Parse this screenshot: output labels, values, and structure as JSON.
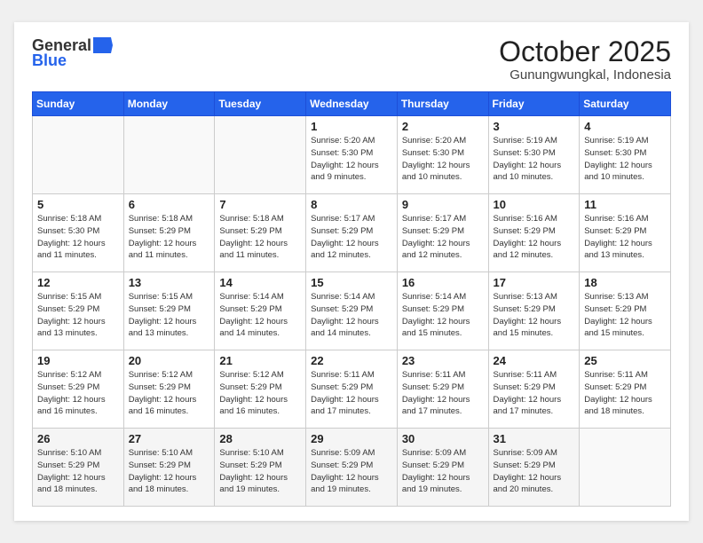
{
  "header": {
    "logo_general": "General",
    "logo_blue": "Blue",
    "month": "October 2025",
    "location": "Gunungwungkal, Indonesia"
  },
  "weekdays": [
    "Sunday",
    "Monday",
    "Tuesday",
    "Wednesday",
    "Thursday",
    "Friday",
    "Saturday"
  ],
  "weeks": [
    [
      {
        "day": "",
        "info": ""
      },
      {
        "day": "",
        "info": ""
      },
      {
        "day": "",
        "info": ""
      },
      {
        "day": "1",
        "info": "Sunrise: 5:20 AM\nSunset: 5:30 PM\nDaylight: 12 hours\nand 9 minutes."
      },
      {
        "day": "2",
        "info": "Sunrise: 5:20 AM\nSunset: 5:30 PM\nDaylight: 12 hours\nand 10 minutes."
      },
      {
        "day": "3",
        "info": "Sunrise: 5:19 AM\nSunset: 5:30 PM\nDaylight: 12 hours\nand 10 minutes."
      },
      {
        "day": "4",
        "info": "Sunrise: 5:19 AM\nSunset: 5:30 PM\nDaylight: 12 hours\nand 10 minutes."
      }
    ],
    [
      {
        "day": "5",
        "info": "Sunrise: 5:18 AM\nSunset: 5:30 PM\nDaylight: 12 hours\nand 11 minutes."
      },
      {
        "day": "6",
        "info": "Sunrise: 5:18 AM\nSunset: 5:29 PM\nDaylight: 12 hours\nand 11 minutes."
      },
      {
        "day": "7",
        "info": "Sunrise: 5:18 AM\nSunset: 5:29 PM\nDaylight: 12 hours\nand 11 minutes."
      },
      {
        "day": "8",
        "info": "Sunrise: 5:17 AM\nSunset: 5:29 PM\nDaylight: 12 hours\nand 12 minutes."
      },
      {
        "day": "9",
        "info": "Sunrise: 5:17 AM\nSunset: 5:29 PM\nDaylight: 12 hours\nand 12 minutes."
      },
      {
        "day": "10",
        "info": "Sunrise: 5:16 AM\nSunset: 5:29 PM\nDaylight: 12 hours\nand 12 minutes."
      },
      {
        "day": "11",
        "info": "Sunrise: 5:16 AM\nSunset: 5:29 PM\nDaylight: 12 hours\nand 13 minutes."
      }
    ],
    [
      {
        "day": "12",
        "info": "Sunrise: 5:15 AM\nSunset: 5:29 PM\nDaylight: 12 hours\nand 13 minutes."
      },
      {
        "day": "13",
        "info": "Sunrise: 5:15 AM\nSunset: 5:29 PM\nDaylight: 12 hours\nand 13 minutes."
      },
      {
        "day": "14",
        "info": "Sunrise: 5:14 AM\nSunset: 5:29 PM\nDaylight: 12 hours\nand 14 minutes."
      },
      {
        "day": "15",
        "info": "Sunrise: 5:14 AM\nSunset: 5:29 PM\nDaylight: 12 hours\nand 14 minutes."
      },
      {
        "day": "16",
        "info": "Sunrise: 5:14 AM\nSunset: 5:29 PM\nDaylight: 12 hours\nand 15 minutes."
      },
      {
        "day": "17",
        "info": "Sunrise: 5:13 AM\nSunset: 5:29 PM\nDaylight: 12 hours\nand 15 minutes."
      },
      {
        "day": "18",
        "info": "Sunrise: 5:13 AM\nSunset: 5:29 PM\nDaylight: 12 hours\nand 15 minutes."
      }
    ],
    [
      {
        "day": "19",
        "info": "Sunrise: 5:12 AM\nSunset: 5:29 PM\nDaylight: 12 hours\nand 16 minutes."
      },
      {
        "day": "20",
        "info": "Sunrise: 5:12 AM\nSunset: 5:29 PM\nDaylight: 12 hours\nand 16 minutes."
      },
      {
        "day": "21",
        "info": "Sunrise: 5:12 AM\nSunset: 5:29 PM\nDaylight: 12 hours\nand 16 minutes."
      },
      {
        "day": "22",
        "info": "Sunrise: 5:11 AM\nSunset: 5:29 PM\nDaylight: 12 hours\nand 17 minutes."
      },
      {
        "day": "23",
        "info": "Sunrise: 5:11 AM\nSunset: 5:29 PM\nDaylight: 12 hours\nand 17 minutes."
      },
      {
        "day": "24",
        "info": "Sunrise: 5:11 AM\nSunset: 5:29 PM\nDaylight: 12 hours\nand 17 minutes."
      },
      {
        "day": "25",
        "info": "Sunrise: 5:11 AM\nSunset: 5:29 PM\nDaylight: 12 hours\nand 18 minutes."
      }
    ],
    [
      {
        "day": "26",
        "info": "Sunrise: 5:10 AM\nSunset: 5:29 PM\nDaylight: 12 hours\nand 18 minutes."
      },
      {
        "day": "27",
        "info": "Sunrise: 5:10 AM\nSunset: 5:29 PM\nDaylight: 12 hours\nand 18 minutes."
      },
      {
        "day": "28",
        "info": "Sunrise: 5:10 AM\nSunset: 5:29 PM\nDaylight: 12 hours\nand 19 minutes."
      },
      {
        "day": "29",
        "info": "Sunrise: 5:09 AM\nSunset: 5:29 PM\nDaylight: 12 hours\nand 19 minutes."
      },
      {
        "day": "30",
        "info": "Sunrise: 5:09 AM\nSunset: 5:29 PM\nDaylight: 12 hours\nand 19 minutes."
      },
      {
        "day": "31",
        "info": "Sunrise: 5:09 AM\nSunset: 5:29 PM\nDaylight: 12 hours\nand 20 minutes."
      },
      {
        "day": "",
        "info": ""
      }
    ]
  ]
}
